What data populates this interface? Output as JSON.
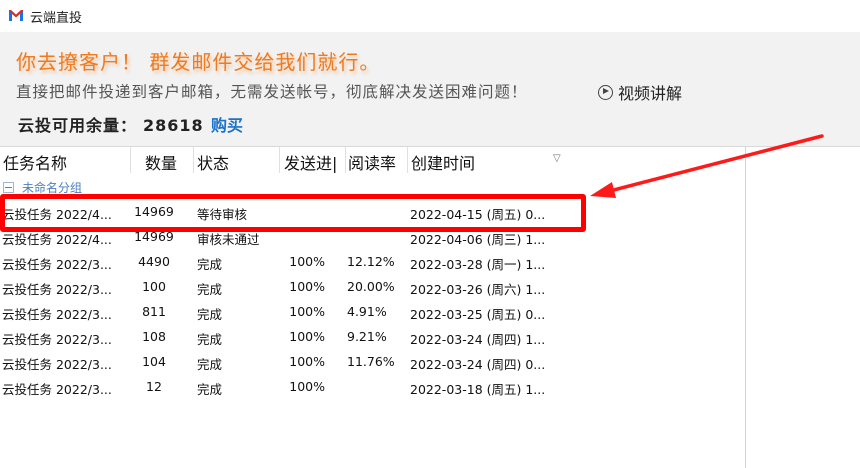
{
  "app": {
    "title": "云端直投"
  },
  "banner": {
    "headline": "你去撩客户！ 群发邮件交给我们就行。",
    "subline": "直接把邮件投递到客户邮箱，无需发送帐号，彻底解决发送困难问题！",
    "video_label": "视频讲解",
    "balance_label": "云投可用余量：",
    "balance_value": "28618",
    "buy_label": "购买"
  },
  "table": {
    "columns": [
      "任务名称",
      "数量",
      "状态",
      "发送进|",
      "阅读率",
      "创建时间"
    ],
    "group_label": "未命名分组",
    "rows": [
      {
        "name": "云投任务 2022/4...",
        "count": "14969",
        "status": "等待审核",
        "progress": "",
        "read": "",
        "created": "2022-04-15 (周五) 0..."
      },
      {
        "name": "云投任务 2022/4...",
        "count": "14969",
        "status": "审核未通过",
        "progress": "",
        "read": "",
        "created": "2022-04-06 (周三) 1..."
      },
      {
        "name": "云投任务 2022/3...",
        "count": "4490",
        "status": "完成",
        "progress": "100%",
        "read": "12.12%",
        "created": "2022-03-28 (周一) 1..."
      },
      {
        "name": "云投任务 2022/3...",
        "count": "100",
        "status": "完成",
        "progress": "100%",
        "read": "20.00%",
        "created": "2022-03-26 (周六) 1..."
      },
      {
        "name": "云投任务 2022/3...",
        "count": "811",
        "status": "完成",
        "progress": "100%",
        "read": "4.91%",
        "created": "2022-03-25 (周五) 0..."
      },
      {
        "name": "云投任务 2022/3...",
        "count": "108",
        "status": "完成",
        "progress": "100%",
        "read": "9.21%",
        "created": "2022-03-24 (周四) 1..."
      },
      {
        "name": "云投任务 2022/3...",
        "count": "104",
        "status": "完成",
        "progress": "100%",
        "read": "11.76%",
        "created": "2022-03-24 (周四) 0..."
      },
      {
        "name": "云投任务 2022/3...",
        "count": "12",
        "status": "完成",
        "progress": "100%",
        "read": "",
        "created": "2022-03-18 (周五) 1..."
      }
    ]
  },
  "colors": {
    "headline": "#f07a1e",
    "link": "#1a73c9",
    "annotation": "#ff0000"
  }
}
